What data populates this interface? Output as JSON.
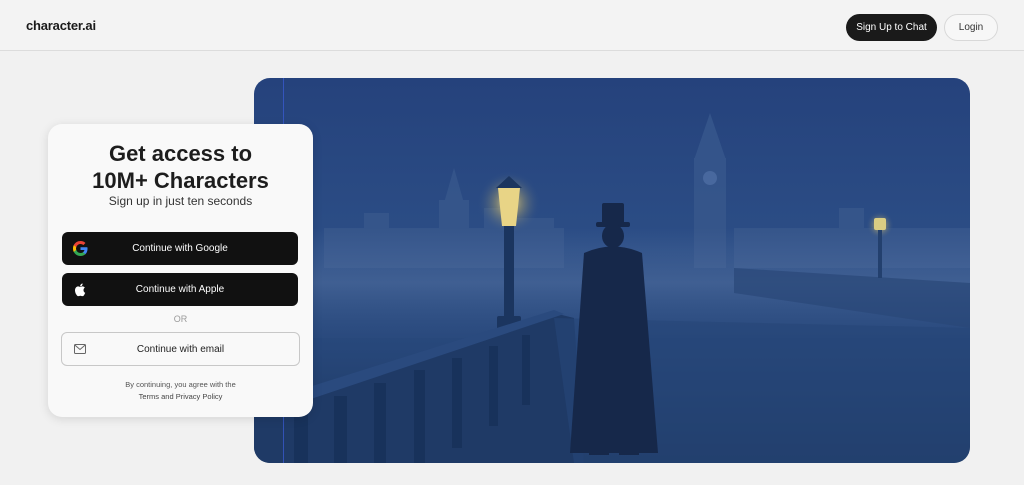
{
  "header": {
    "logo": "character.ai",
    "signup_label": "Sign Up to Chat",
    "login_label": "Login"
  },
  "card": {
    "title_line1": "Get access to",
    "title_line2": "10M+ Characters",
    "subtitle": "Sign up in just ten seconds",
    "google_label": "Continue with Google",
    "apple_label": "Continue with Apple",
    "or_label": "OR",
    "email_label": "Continue with email",
    "legal_line1": "By continuing, you agree with the",
    "legal_terms": "Terms and Privacy Policy"
  },
  "hero": {
    "image_description_icon": "foggy-london-bridge-illustration"
  },
  "colors": {
    "background": "#f1f1f1",
    "primary_button": "#111111",
    "hero_blue": "#2c4e86"
  }
}
